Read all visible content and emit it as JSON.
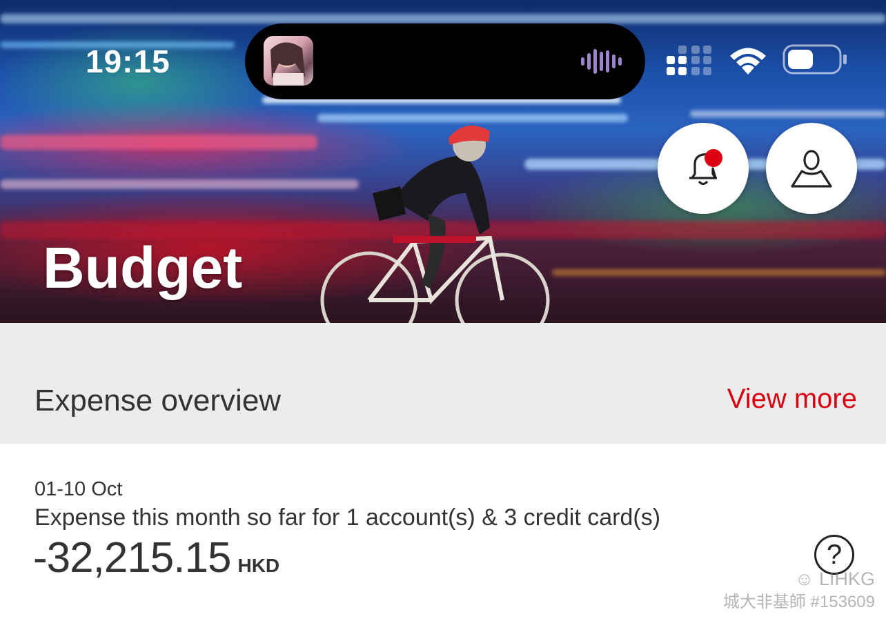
{
  "status_bar": {
    "time": "19:15",
    "icons": [
      "signal-icon",
      "wifi-icon",
      "battery-icon"
    ]
  },
  "header": {
    "title": "Budget",
    "notification_icon": "bell-icon",
    "profile_icon": "person-icon"
  },
  "expense_overview": {
    "title": "Expense overview",
    "view_more_label": "View more"
  },
  "expense_card": {
    "date_range": "01-10 Oct",
    "description": "Expense this month so far for 1 account(s) & 3 credit card(s)",
    "amount": "-32,215.15",
    "currency": "HKD",
    "help_icon": "question-icon"
  },
  "watermark": {
    "brand": "☺ LIHKG",
    "credit": "城大非基師 #153609"
  },
  "colors": {
    "accent": "#db0011",
    "section_bg": "#ececec",
    "text": "#333333"
  }
}
